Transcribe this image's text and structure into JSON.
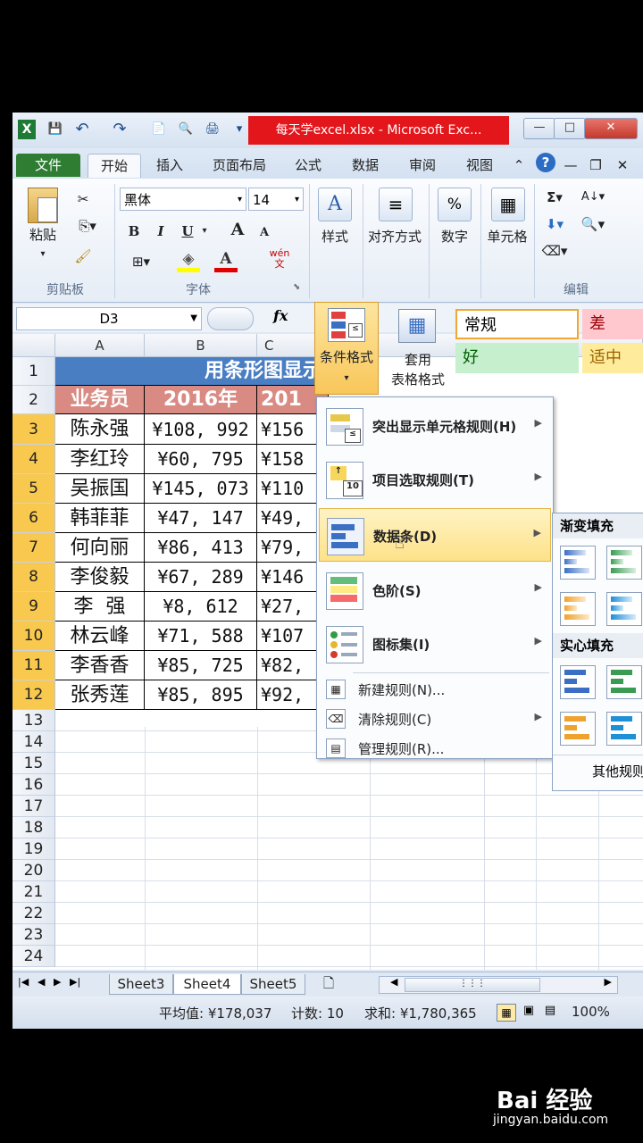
{
  "window": {
    "title": "每天学excel.xlsx - Microsoft Exc...",
    "controls": {
      "minimize": "—",
      "maximize": "□",
      "close": "✕"
    }
  },
  "quick_access": {
    "save": "💾",
    "undo": "↶",
    "redo": "↷",
    "new": "📄",
    "preview": "🔍",
    "print": "🖨",
    "more": "▾"
  },
  "tabs": [
    "文件",
    "开始",
    "插入",
    "页面布局",
    "公式",
    "数据",
    "审阅",
    "视图"
  ],
  "ribbon": {
    "clipboard": {
      "paste_label": "粘贴",
      "group_label": "剪贴板"
    },
    "font": {
      "name": "黑体",
      "size": "14",
      "group_label": "字体",
      "bold": "B",
      "italic": "I",
      "underline": "U",
      "grow": "A",
      "shrink": "A",
      "wen": "wén\n文"
    },
    "styles_label": "样式",
    "align_label": "对齐方式",
    "number_label": "数字",
    "number_icon": "%",
    "cells_label": "单元格",
    "edit_label": "编辑",
    "cf_label": "条件格式",
    "table_format_label": "套用\n表格格式",
    "cell_styles": [
      {
        "label": "常规",
        "color": "#ffffff",
        "border": "#f0a830"
      },
      {
        "label": "差",
        "color": "#ffc7ce",
        "text": "#9c0006"
      },
      {
        "label": "好",
        "color": "#c6efce",
        "text": "#006100"
      },
      {
        "label": "适中",
        "color": "#ffeb9c",
        "text": "#9c6500"
      }
    ]
  },
  "formula_bar": {
    "name_box": "D3",
    "fx": "fx"
  },
  "sheet": {
    "columns": [
      "A",
      "B",
      "C"
    ],
    "title": "用条形图显示",
    "header": [
      "业务员",
      "2016年",
      "201"
    ],
    "rows": [
      [
        "陈永强",
        "¥108, 992",
        "¥156"
      ],
      [
        "李红玲",
        "¥60, 795",
        "¥158"
      ],
      [
        "吴振国",
        "¥145, 073",
        "¥110"
      ],
      [
        "韩菲菲",
        "¥47, 147",
        "¥49,"
      ],
      [
        "何向丽",
        "¥86, 413",
        "¥79,"
      ],
      [
        "李俊毅",
        "¥67, 289",
        "¥146"
      ],
      [
        "李  强",
        "¥8, 612",
        "¥27,"
      ],
      [
        "林云峰",
        "¥71, 588",
        "¥107"
      ],
      [
        "李香香",
        "¥85, 725",
        "¥82,"
      ],
      [
        "张秀莲",
        "¥85, 895",
        "¥92,"
      ]
    ],
    "row_numbers": [
      "1",
      "2",
      "3",
      "4",
      "5",
      "6",
      "7",
      "8",
      "9",
      "10",
      "11",
      "12",
      "13",
      "14",
      "15",
      "16",
      "17",
      "18",
      "19",
      "20",
      "21",
      "22",
      "23",
      "24"
    ]
  },
  "cf_menu": {
    "items": [
      {
        "label": "突出显示单元格规则(H)"
      },
      {
        "label": "项目选取规则(T)"
      },
      {
        "label": "数据条(D)"
      },
      {
        "label": "色阶(S)"
      },
      {
        "label": "图标集(I)"
      }
    ],
    "small_items": [
      {
        "label": "新建规则(N)..."
      },
      {
        "label": "清除规则(C)"
      },
      {
        "label": "管理规则(R)..."
      }
    ]
  },
  "databar_submenu": {
    "gradient": "渐变填充",
    "solid": "实心填充",
    "more": "其他规则"
  },
  "sheet_tabs": [
    "Sheet3",
    "Sheet4",
    "Sheet5"
  ],
  "status": {
    "average": "平均值: ¥178,037",
    "count": "计数: 10",
    "sum": "求和: ¥1,780,365",
    "zoom": "100%"
  },
  "watermark": {
    "logo": "Bai 经验",
    "url": "jingyan.baidu.com"
  }
}
